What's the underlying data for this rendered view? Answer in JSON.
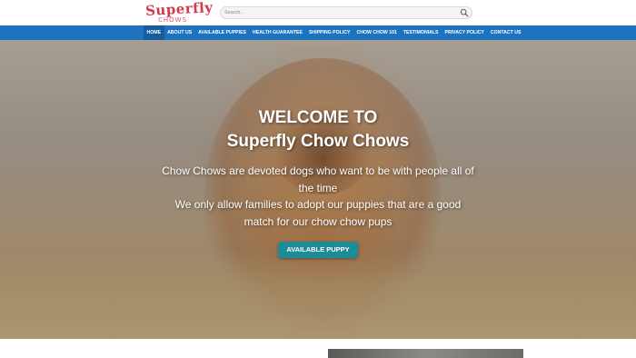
{
  "header": {
    "logo_text": "Superfly",
    "logo_sub": "CHOWS",
    "search_placeholder": "Search...",
    "search_icon": "search-icon"
  },
  "nav": {
    "items": [
      {
        "label": "Home",
        "active": true
      },
      {
        "label": "About Us"
      },
      {
        "label": "Available Puppies"
      },
      {
        "label": "Health Guarantee"
      },
      {
        "label": "Shipping Policy"
      },
      {
        "label": "Chow Chow 101"
      },
      {
        "label": "Testimonials"
      },
      {
        "label": "Privacy Policy"
      },
      {
        "label": "Contact Us"
      }
    ],
    "color": "#1e73be"
  },
  "hero": {
    "title_line1": "WELCOME TO",
    "title_line2": "Superfly Chow Chows",
    "text_line1": "Chow Chows are devoted dogs who want to be with people all of the time",
    "text_line2": "We only allow families to adopt our puppies that are a good match for our chow chow pups",
    "button_label": "Available Puppy",
    "button_color": "#1d8c98"
  }
}
